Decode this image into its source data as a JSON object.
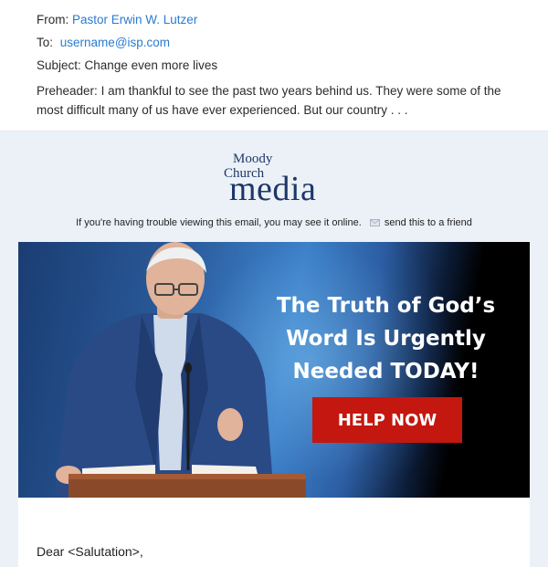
{
  "header": {
    "from_label": "From:",
    "from_value": "Pastor Erwin W. Lutzer",
    "to_label": "To:",
    "to_value": "username@isp.com",
    "subject_label": "Subject:",
    "subject_value": "Change even more lives",
    "preheader_label": "Preheader:",
    "preheader_value": "I am thankful to see the past two years behind us. They were some of the most difficult many of us have ever experienced. But our country . . ."
  },
  "logo": {
    "line1": "Moody",
    "line2": "Church",
    "line3": "media"
  },
  "viewline": {
    "text": "If you're having trouble viewing this email, you may see it online.",
    "share": "send this to a friend"
  },
  "banner": {
    "headline": "The Truth of God’s Word Is Urgently Needed TODAY!",
    "cta": "HELP NOW"
  },
  "body": {
    "greeting": "Dear <Salutation>,"
  },
  "colors": {
    "link": "#2a7bd1",
    "cta": "#c4170f",
    "email_bg": "#ebf1f7",
    "logo": "#1e3768"
  }
}
